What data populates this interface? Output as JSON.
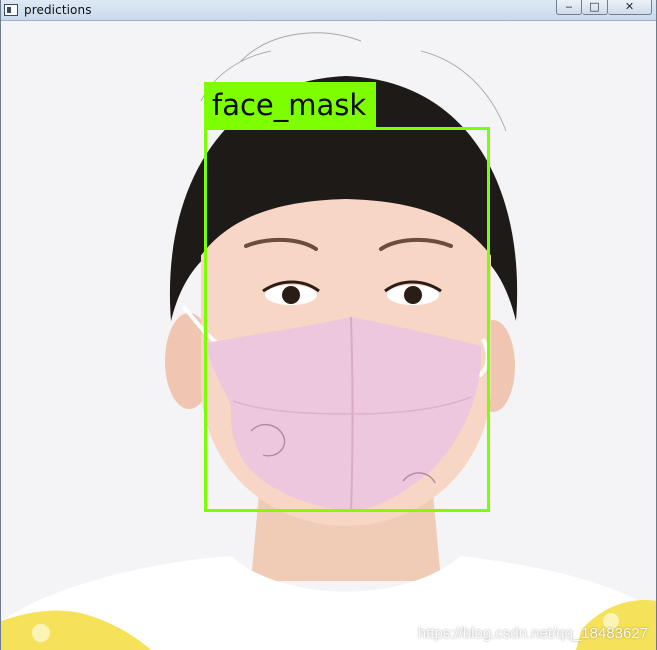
{
  "window": {
    "title": "predictions",
    "controls": {
      "minimize": "‒",
      "maximize": "□",
      "close": "✕"
    }
  },
  "detection": {
    "label": "face_mask",
    "box_color": "#7dff00"
  },
  "watermark": "https://blog.csdn.net/qq_18483627"
}
